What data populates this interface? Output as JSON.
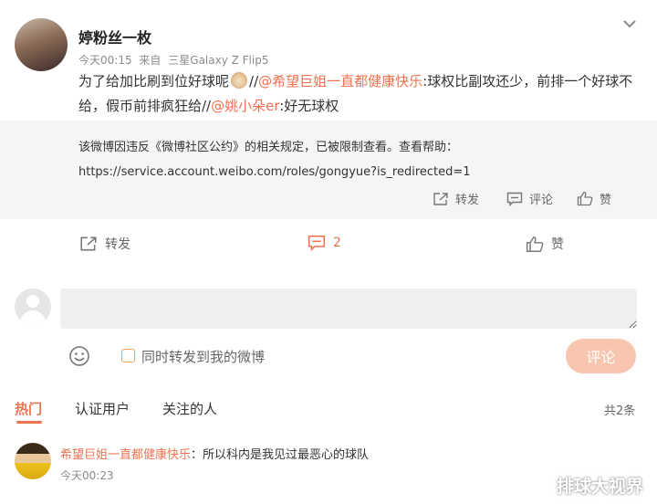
{
  "post": {
    "author": "婷粉丝一枚",
    "time": "今天00:15",
    "source_prefix": "来自",
    "source": "三星Galaxy Z Flip5",
    "text_part1": "为了给加比刷到位好球呢",
    "text_part2": "//",
    "mention1": "@希望巨姐一直都健康快乐",
    "text_part3": ":球权比副攻还少，前排一个好球不给，假币前排疯狂给//",
    "mention2": "@姚小朵er",
    "text_part4": ":好无球权"
  },
  "repost": {
    "restricted_notice": "该微博因违反《微博社区公约》的相关规定，已被限制查看。查看帮助：",
    "help_link": "https://service.account.weibo.com/roles/gongyue?is_redirected=1",
    "forward_label": "转发",
    "comment_label": "评论",
    "like_label": "赞"
  },
  "actions": {
    "forward_label": "转发",
    "comment_count": "2",
    "like_label": "赞"
  },
  "composer": {
    "placeholder": "",
    "sync_label": "同时转发到我的微博",
    "submit_label": "评论"
  },
  "filters": {
    "tabs": [
      "热门",
      "认证用户",
      "关注的人"
    ],
    "total": "共2条"
  },
  "comments": [
    {
      "user": "希望巨姐一直都健康快乐",
      "separator": "：",
      "text": "所以科内是我见过最恶心的球队",
      "time": "今天00:23"
    }
  ],
  "watermark": "排球大视界",
  "colors": {
    "accent": "#eb7350",
    "submit_disabled": "#f8c6b0",
    "panel_bg": "#f5f5f5"
  }
}
